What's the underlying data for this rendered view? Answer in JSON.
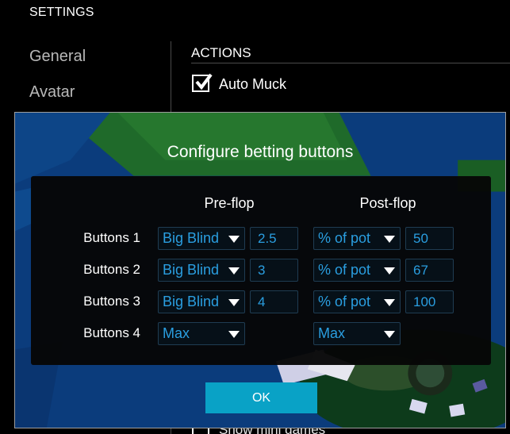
{
  "settings": {
    "title": "SETTINGS",
    "nav": [
      "General",
      "Avatar"
    ],
    "section_title": "ACTIONS",
    "auto_muck_label": "Auto Muck",
    "show_mini_games_label": "Show mini games"
  },
  "dialog": {
    "title": "Configure betting buttons",
    "preflop_header": "Pre-flop",
    "postflop_header": "Post-flop",
    "rows": [
      {
        "label": "Buttons 1",
        "pre_type": "Big Blind",
        "pre_value": "2.5",
        "post_type": "% of pot",
        "post_value": "50"
      },
      {
        "label": "Buttons 2",
        "pre_type": "Big Blind",
        "pre_value": "3",
        "post_type": "% of pot",
        "post_value": "67"
      },
      {
        "label": "Buttons 3",
        "pre_type": "Big Blind",
        "pre_value": "4",
        "post_type": "% of pot",
        "post_value": "100"
      },
      {
        "label": "Buttons 4",
        "pre_type": "Max",
        "post_type": "Max"
      }
    ],
    "ok_label": "OK"
  },
  "colors": {
    "accent": "#09a2c6",
    "field_text": "#2a9ee0",
    "background": "#000000"
  },
  "icons": [
    "checkbox-checked-icon",
    "chevron-down-icon"
  ]
}
